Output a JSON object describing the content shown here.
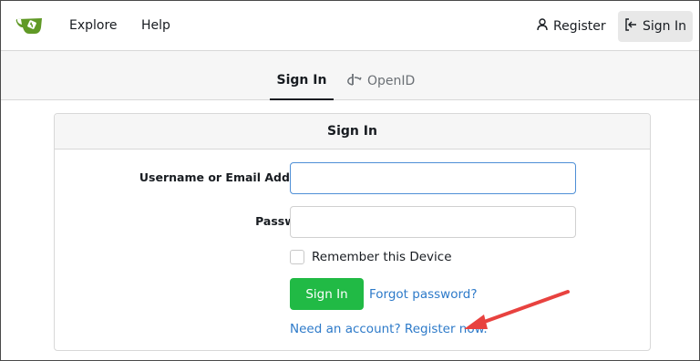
{
  "navbar": {
    "logo_icon": "gitea-teacup-icon",
    "explore_label": "Explore",
    "help_label": "Help",
    "register_label": "Register",
    "register_icon": "person-icon",
    "signin_label": "Sign In",
    "signin_icon": "sign-in-icon"
  },
  "tabs": [
    {
      "label": "Sign In",
      "active": true
    },
    {
      "label": "OpenID",
      "active": false,
      "icon": "openid-icon"
    }
  ],
  "form": {
    "header": "Sign In",
    "username_label": "Username or Email Address",
    "password_label": "Password",
    "required_marker": "*",
    "username_value": "",
    "password_value": "",
    "remember_label": "Remember this Device",
    "remember_checked": false,
    "submit_label": "Sign In",
    "forgot_label": "Forgot password?",
    "register_link_label": "Need an account? Register now."
  },
  "colors": {
    "primary_button": "#21ba45",
    "link": "#2d7ac9",
    "required": "#db2828",
    "annotation_arrow": "#e8423f",
    "focus_border": "#4e8fd6"
  }
}
